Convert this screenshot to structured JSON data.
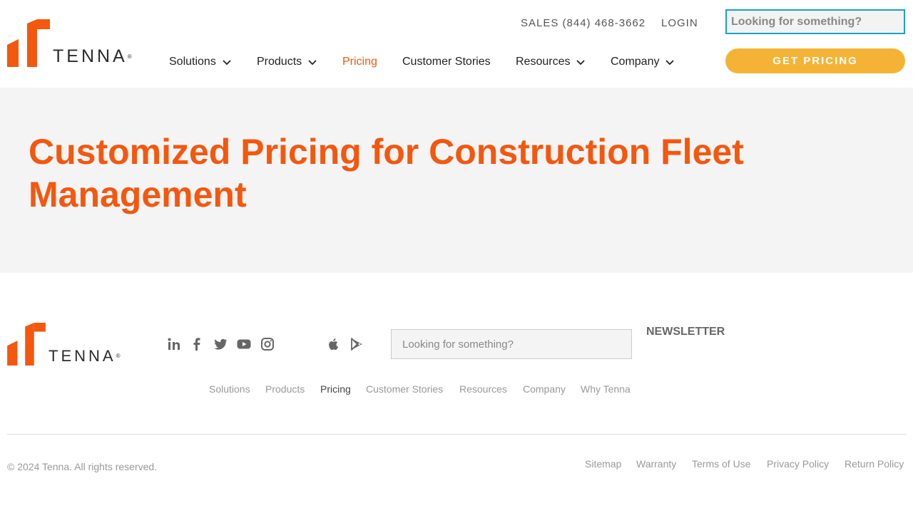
{
  "brand": {
    "name": "TENNA",
    "mark": "®",
    "orange": "#f4570e",
    "dark": "#2b2b2b"
  },
  "header": {
    "sales": "SALES (844) 468-3662",
    "login": "LOGIN",
    "search_placeholder": "Looking for something?",
    "cta": "GET PRICING",
    "nav": [
      {
        "label": "Solutions",
        "dropdown": true
      },
      {
        "label": "Products",
        "dropdown": true
      },
      {
        "label": "Pricing",
        "dropdown": false,
        "active": true
      },
      {
        "label": "Customer Stories",
        "dropdown": false
      },
      {
        "label": "Resources",
        "dropdown": true
      },
      {
        "label": "Company",
        "dropdown": true
      }
    ]
  },
  "hero": {
    "title": "Customized Pricing for Construction Fleet Management"
  },
  "footer": {
    "social": [
      "linkedin-icon",
      "facebook-icon",
      "twitter-icon",
      "youtube-icon",
      "instagram-icon"
    ],
    "apps": [
      "apple-icon",
      "google-play-icon"
    ],
    "search_placeholder": "Looking for something?",
    "newsletter": "NEWSLETTER",
    "nav": [
      "Solutions",
      "Products",
      "Pricing",
      "Customer Stories",
      "Resources",
      "Company",
      "Why Tenna"
    ],
    "active_nav": "Pricing",
    "copyright": "© 2024 Tenna. All rights reserved.",
    "legal": [
      "Sitemap",
      "Warranty",
      "Terms of Use",
      "Privacy Policy",
      "Return Policy"
    ]
  },
  "colors": {
    "accent": "#f4570e",
    "cta": "#f5b335",
    "search_border": "#1aa3c8",
    "hero_bg": "#f4f4f4"
  }
}
